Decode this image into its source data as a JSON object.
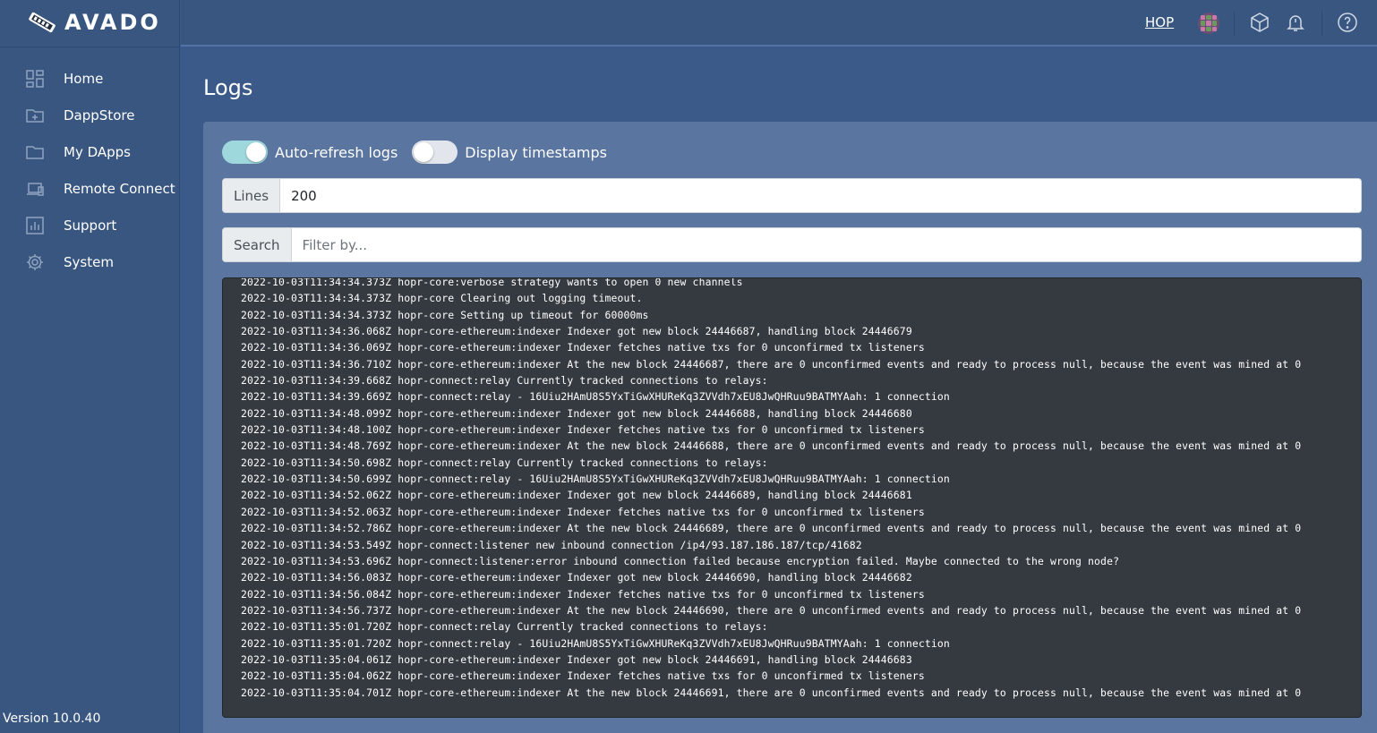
{
  "app": {
    "brand": "AVADO",
    "version": "Version 10.0.40"
  },
  "sidebar": {
    "items": [
      {
        "label": "Home",
        "icon": "dashboard-icon"
      },
      {
        "label": "DappStore",
        "icon": "folder-plus-icon"
      },
      {
        "label": "My DApps",
        "icon": "folder-icon"
      },
      {
        "label": "Remote Connect",
        "icon": "devices-icon"
      },
      {
        "label": "Support",
        "icon": "bar-chart-icon"
      },
      {
        "label": "System",
        "icon": "gear-icon"
      }
    ]
  },
  "header": {
    "link": "HOP",
    "icons": [
      "avatar",
      "package-icon",
      "bell-icon",
      "help-icon"
    ]
  },
  "page": {
    "title": "Logs",
    "toggles": [
      {
        "label": "Auto-refresh logs",
        "on": true
      },
      {
        "label": "Display timestamps",
        "on": false
      }
    ],
    "lines": {
      "label": "Lines",
      "value": "200"
    },
    "search": {
      "label": "Search",
      "placeholder": "Filter by..."
    }
  },
  "logs": [
    "2022-10-03T11:34:34.373Z hopr-core:verbose strategy wants to open 0 new channels",
    "2022-10-03T11:34:34.373Z hopr-core Clearing out logging timeout.",
    "2022-10-03T11:34:34.373Z hopr-core Setting up timeout for 60000ms",
    "2022-10-03T11:34:36.068Z hopr-core-ethereum:indexer Indexer got new block 24446687, handling block 24446679",
    "2022-10-03T11:34:36.069Z hopr-core-ethereum:indexer Indexer fetches native txs for 0 unconfirmed tx listeners",
    "2022-10-03T11:34:36.710Z hopr-core-ethereum:indexer At the new block 24446687, there are 0 unconfirmed events and ready to process null, because the event was mined at 0",
    "2022-10-03T11:34:39.668Z hopr-connect:relay Currently tracked connections to relays:",
    "2022-10-03T11:34:39.669Z hopr-connect:relay - 16Uiu2HAmU8S5YxTiGwXHUReKq3ZVVdh7xEU8JwQHRuu9BATMYAah: 1 connection",
    "2022-10-03T11:34:48.099Z hopr-core-ethereum:indexer Indexer got new block 24446688, handling block 24446680",
    "2022-10-03T11:34:48.100Z hopr-core-ethereum:indexer Indexer fetches native txs for 0 unconfirmed tx listeners",
    "2022-10-03T11:34:48.769Z hopr-core-ethereum:indexer At the new block 24446688, there are 0 unconfirmed events and ready to process null, because the event was mined at 0",
    "2022-10-03T11:34:50.698Z hopr-connect:relay Currently tracked connections to relays:",
    "2022-10-03T11:34:50.699Z hopr-connect:relay - 16Uiu2HAmU8S5YxTiGwXHUReKq3ZVVdh7xEU8JwQHRuu9BATMYAah: 1 connection",
    "2022-10-03T11:34:52.062Z hopr-core-ethereum:indexer Indexer got new block 24446689, handling block 24446681",
    "2022-10-03T11:34:52.063Z hopr-core-ethereum:indexer Indexer fetches native txs for 0 unconfirmed tx listeners",
    "2022-10-03T11:34:52.786Z hopr-core-ethereum:indexer At the new block 24446689, there are 0 unconfirmed events and ready to process null, because the event was mined at 0",
    "2022-10-03T11:34:53.549Z hopr-connect:listener new inbound connection /ip4/93.187.186.187/tcp/41682",
    "2022-10-03T11:34:53.696Z hopr-connect:listener:error inbound connection failed because encryption failed. Maybe connected to the wrong node?",
    "2022-10-03T11:34:56.083Z hopr-core-ethereum:indexer Indexer got new block 24446690, handling block 24446682",
    "2022-10-03T11:34:56.084Z hopr-core-ethereum:indexer Indexer fetches native txs for 0 unconfirmed tx listeners",
    "2022-10-03T11:34:56.737Z hopr-core-ethereum:indexer At the new block 24446690, there are 0 unconfirmed events and ready to process null, because the event was mined at 0",
    "2022-10-03T11:35:01.720Z hopr-connect:relay Currently tracked connections to relays:",
    "2022-10-03T11:35:01.720Z hopr-connect:relay - 16Uiu2HAmU8S5YxTiGwXHUReKq3ZVVdh7xEU8JwQHRuu9BATMYAah: 1 connection",
    "2022-10-03T11:35:04.061Z hopr-core-ethereum:indexer Indexer got new block 24446691, handling block 24446683",
    "2022-10-03T11:35:04.062Z hopr-core-ethereum:indexer Indexer fetches native txs for 0 unconfirmed tx listeners",
    "2022-10-03T11:35:04.701Z hopr-core-ethereum:indexer At the new block 24446691, there are 0 unconfirmed events and ready to process null, because the event was mined at 0"
  ]
}
